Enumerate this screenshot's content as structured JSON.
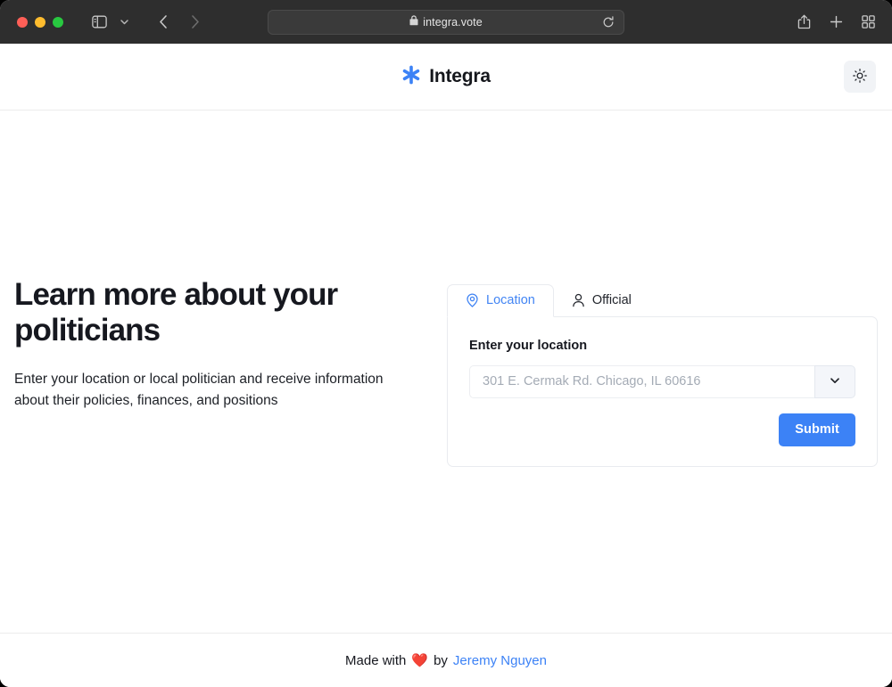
{
  "browser": {
    "url": "integra.vote",
    "lock_icon": "lock-icon",
    "reload_icon": "reload-icon",
    "back_icon": "chevron-left-icon",
    "forward_icon": "chevron-right-icon",
    "sidebar_icon": "sidebar-icon",
    "sidebar_chevron_icon": "chevron-down-icon",
    "shield_icon": "shield-icon",
    "share_icon": "share-icon",
    "new_tab_icon": "plus-icon",
    "tab_overview_icon": "tab-overview-icon",
    "traffic_lights": [
      "close",
      "minimize",
      "maximize"
    ]
  },
  "header": {
    "brand_name": "Integra",
    "brand_mark_icon": "asterisk-sparkle-icon",
    "theme_toggle_icon": "sun-icon",
    "brand_color": "#3c82f6"
  },
  "hero": {
    "title": "Learn more about your politicians",
    "subtitle": "Enter your location or local politician and receive information about their policies, finances, and positions"
  },
  "form": {
    "tabs": [
      {
        "label": "Location",
        "icon": "map-pin-icon",
        "active": true
      },
      {
        "label": "Official",
        "icon": "person-icon",
        "active": false
      }
    ],
    "field_label": "Enter your location",
    "input_value": "",
    "input_placeholder": "301 E. Cermak Rd. Chicago, IL 60616",
    "dropdown_icon": "chevron-down-icon",
    "submit_label": "Submit",
    "accent_color": "#3c82f6"
  },
  "footer": {
    "prefix": "Made with",
    "heart": "❤️",
    "middle": "by",
    "link_text": "Jeremy Nguyen",
    "link_color": "#3c82f6"
  }
}
